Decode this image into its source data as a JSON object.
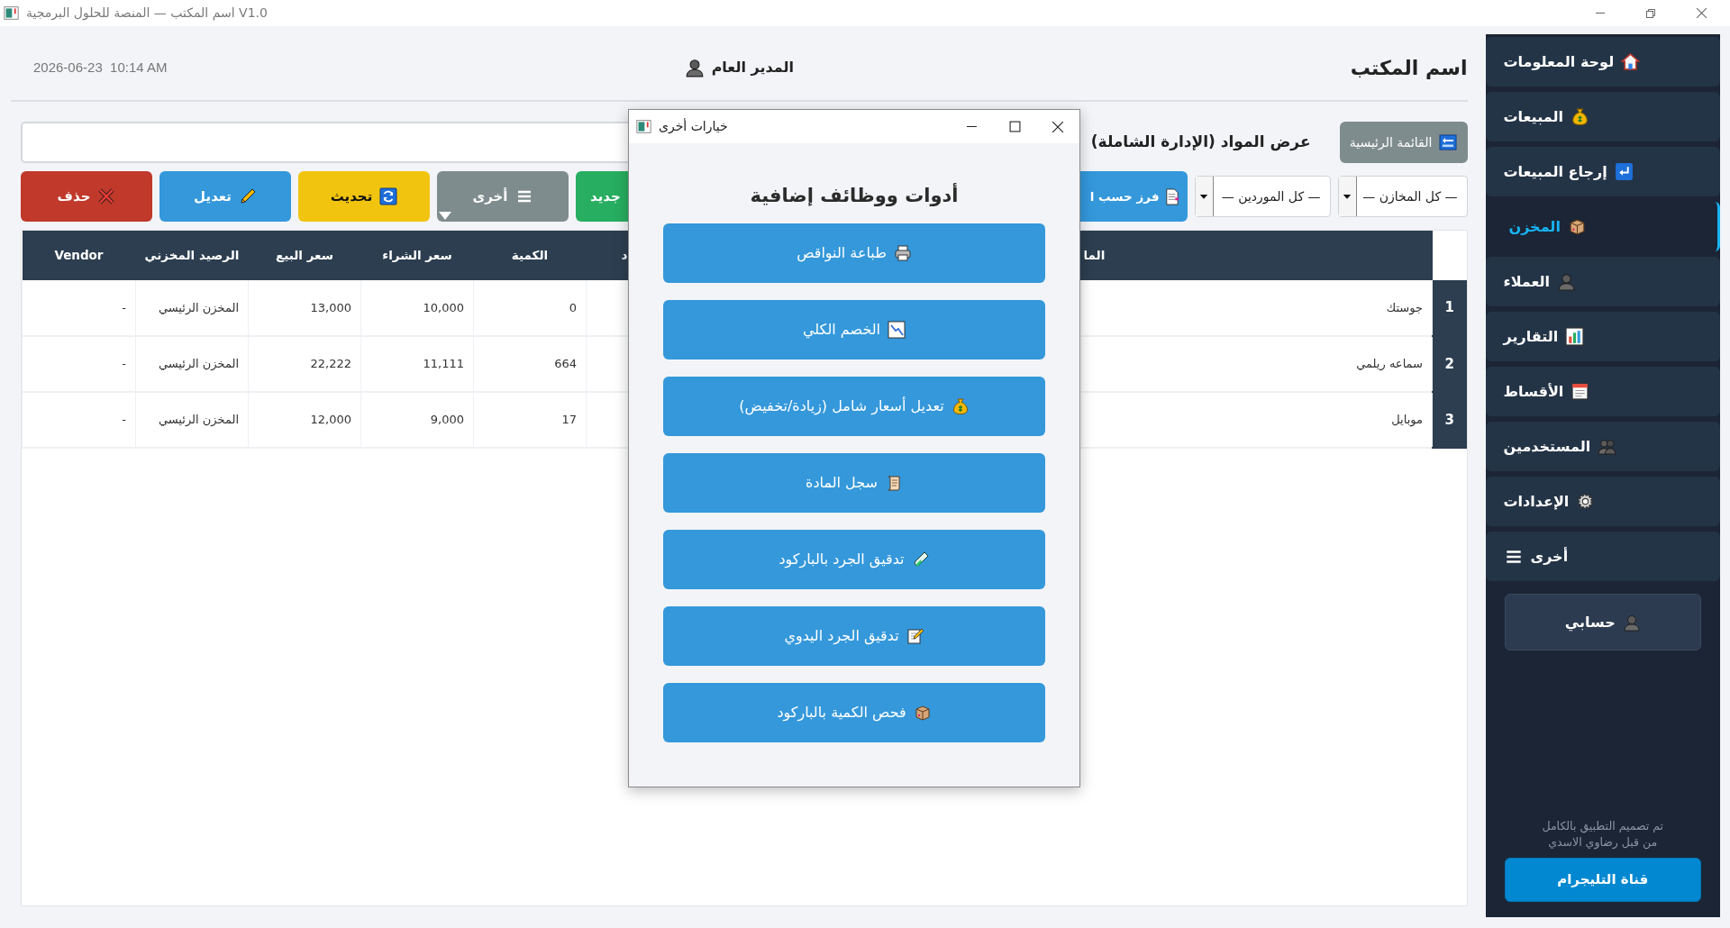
{
  "window": {
    "title": "V1.0 اسم المكتب — المنصة للحلول البرمجية"
  },
  "header": {
    "office_name": "اسم المكتب",
    "user": "المدير العام",
    "datetime": "2026-06-23  10:14 AM"
  },
  "main_menu_button": "القائمة الرئيسية",
  "page_title": "عرض المواد (الإدارة الشاملة)",
  "filters": [
    {
      "value": "— كل المخازن —"
    },
    {
      "value": "— كل الموردين —"
    }
  ],
  "sort_button": "فرز حسب ا",
  "toolbar": [
    {
      "label": "جديد",
      "kind": "new"
    },
    {
      "label": "أخرى",
      "kind": "more"
    },
    {
      "label": "تحديث",
      "kind": "refresh"
    },
    {
      "label": "تعديل",
      "kind": "edit"
    },
    {
      "label": "حذف",
      "kind": "delete"
    }
  ],
  "table": {
    "columns": [
      "الما",
      "د",
      "الكمية",
      "سعر الشراء",
      "سعر البيع",
      "الرصيد المخزني",
      "Vendor"
    ],
    "rows": [
      {
        "number": "1",
        "name": "جوستك",
        "quantity": "0",
        "buy_price": "10,000",
        "sell_price": "13,000",
        "warehouse": "المخزن الرئيسي",
        "vendor": "-"
      },
      {
        "number": "2",
        "name": "سماعه ريلمي",
        "quantity": "664",
        "buy_price": "11,111",
        "sell_price": "22,222",
        "warehouse": "المخزن الرئيسي",
        "vendor": "-"
      },
      {
        "number": "3",
        "name": "موبايل",
        "quantity": "17",
        "buy_price": "9,000",
        "sell_price": "12,000",
        "warehouse": "المخزن الرئيسي",
        "vendor": "-"
      }
    ]
  },
  "sidebar": {
    "items": [
      {
        "label": "لوحة المعلومات",
        "selected": false
      },
      {
        "label": "المبيعات",
        "selected": false
      },
      {
        "label": "إرجاع المبيعات",
        "selected": false
      },
      {
        "label": "المخزن",
        "selected": true
      },
      {
        "label": "العملاء",
        "selected": false
      },
      {
        "label": "التقارير",
        "selected": false
      },
      {
        "label": "الأقساط",
        "selected": false
      },
      {
        "label": "المستخدمين",
        "selected": false
      },
      {
        "label": "الإعدادات",
        "selected": false
      },
      {
        "label": "أخرى",
        "selected": false
      }
    ],
    "account_button": "حسابي",
    "credit_lines": [
      "تم تصميم التطبيق بالكامل",
      "من قبل رضاوي الاسدي"
    ],
    "telegram_button": "قناة التليجرام"
  },
  "dialog": {
    "title": "خيارات أخرى",
    "heading": "أدوات ووظائف إضافية",
    "buttons": [
      "طباعة النواقص",
      "الخصم الكلي",
      "تعديل أسعار شامل (زيادة/تخفيض)",
      "سجل المادة",
      "تدقيق الجرد بالباركود",
      "تدقيق الجرد اليدوي",
      "فحص الكمية بالباركود"
    ]
  }
}
